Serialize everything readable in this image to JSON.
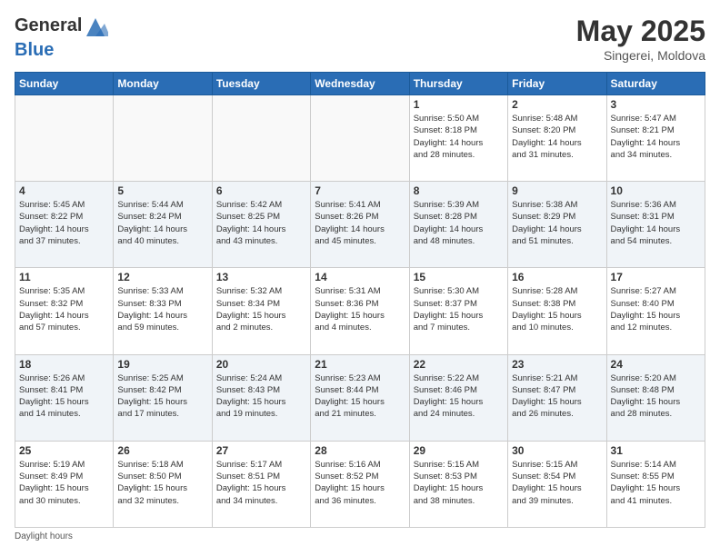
{
  "header": {
    "logo_general": "General",
    "logo_blue": "Blue",
    "title": "May 2025",
    "location": "Singerei, Moldova"
  },
  "calendar": {
    "days_of_week": [
      "Sunday",
      "Monday",
      "Tuesday",
      "Wednesday",
      "Thursday",
      "Friday",
      "Saturday"
    ],
    "weeks": [
      [
        {
          "day": "",
          "info": ""
        },
        {
          "day": "",
          "info": ""
        },
        {
          "day": "",
          "info": ""
        },
        {
          "day": "",
          "info": ""
        },
        {
          "day": "1",
          "info": "Sunrise: 5:50 AM\nSunset: 8:18 PM\nDaylight: 14 hours\nand 28 minutes."
        },
        {
          "day": "2",
          "info": "Sunrise: 5:48 AM\nSunset: 8:20 PM\nDaylight: 14 hours\nand 31 minutes."
        },
        {
          "day": "3",
          "info": "Sunrise: 5:47 AM\nSunset: 8:21 PM\nDaylight: 14 hours\nand 34 minutes."
        }
      ],
      [
        {
          "day": "4",
          "info": "Sunrise: 5:45 AM\nSunset: 8:22 PM\nDaylight: 14 hours\nand 37 minutes."
        },
        {
          "day": "5",
          "info": "Sunrise: 5:44 AM\nSunset: 8:24 PM\nDaylight: 14 hours\nand 40 minutes."
        },
        {
          "day": "6",
          "info": "Sunrise: 5:42 AM\nSunset: 8:25 PM\nDaylight: 14 hours\nand 43 minutes."
        },
        {
          "day": "7",
          "info": "Sunrise: 5:41 AM\nSunset: 8:26 PM\nDaylight: 14 hours\nand 45 minutes."
        },
        {
          "day": "8",
          "info": "Sunrise: 5:39 AM\nSunset: 8:28 PM\nDaylight: 14 hours\nand 48 minutes."
        },
        {
          "day": "9",
          "info": "Sunrise: 5:38 AM\nSunset: 8:29 PM\nDaylight: 14 hours\nand 51 minutes."
        },
        {
          "day": "10",
          "info": "Sunrise: 5:36 AM\nSunset: 8:31 PM\nDaylight: 14 hours\nand 54 minutes."
        }
      ],
      [
        {
          "day": "11",
          "info": "Sunrise: 5:35 AM\nSunset: 8:32 PM\nDaylight: 14 hours\nand 57 minutes."
        },
        {
          "day": "12",
          "info": "Sunrise: 5:33 AM\nSunset: 8:33 PM\nDaylight: 14 hours\nand 59 minutes."
        },
        {
          "day": "13",
          "info": "Sunrise: 5:32 AM\nSunset: 8:34 PM\nDaylight: 15 hours\nand 2 minutes."
        },
        {
          "day": "14",
          "info": "Sunrise: 5:31 AM\nSunset: 8:36 PM\nDaylight: 15 hours\nand 4 minutes."
        },
        {
          "day": "15",
          "info": "Sunrise: 5:30 AM\nSunset: 8:37 PM\nDaylight: 15 hours\nand 7 minutes."
        },
        {
          "day": "16",
          "info": "Sunrise: 5:28 AM\nSunset: 8:38 PM\nDaylight: 15 hours\nand 10 minutes."
        },
        {
          "day": "17",
          "info": "Sunrise: 5:27 AM\nSunset: 8:40 PM\nDaylight: 15 hours\nand 12 minutes."
        }
      ],
      [
        {
          "day": "18",
          "info": "Sunrise: 5:26 AM\nSunset: 8:41 PM\nDaylight: 15 hours\nand 14 minutes."
        },
        {
          "day": "19",
          "info": "Sunrise: 5:25 AM\nSunset: 8:42 PM\nDaylight: 15 hours\nand 17 minutes."
        },
        {
          "day": "20",
          "info": "Sunrise: 5:24 AM\nSunset: 8:43 PM\nDaylight: 15 hours\nand 19 minutes."
        },
        {
          "day": "21",
          "info": "Sunrise: 5:23 AM\nSunset: 8:44 PM\nDaylight: 15 hours\nand 21 minutes."
        },
        {
          "day": "22",
          "info": "Sunrise: 5:22 AM\nSunset: 8:46 PM\nDaylight: 15 hours\nand 24 minutes."
        },
        {
          "day": "23",
          "info": "Sunrise: 5:21 AM\nSunset: 8:47 PM\nDaylight: 15 hours\nand 26 minutes."
        },
        {
          "day": "24",
          "info": "Sunrise: 5:20 AM\nSunset: 8:48 PM\nDaylight: 15 hours\nand 28 minutes."
        }
      ],
      [
        {
          "day": "25",
          "info": "Sunrise: 5:19 AM\nSunset: 8:49 PM\nDaylight: 15 hours\nand 30 minutes."
        },
        {
          "day": "26",
          "info": "Sunrise: 5:18 AM\nSunset: 8:50 PM\nDaylight: 15 hours\nand 32 minutes."
        },
        {
          "day": "27",
          "info": "Sunrise: 5:17 AM\nSunset: 8:51 PM\nDaylight: 15 hours\nand 34 minutes."
        },
        {
          "day": "28",
          "info": "Sunrise: 5:16 AM\nSunset: 8:52 PM\nDaylight: 15 hours\nand 36 minutes."
        },
        {
          "day": "29",
          "info": "Sunrise: 5:15 AM\nSunset: 8:53 PM\nDaylight: 15 hours\nand 38 minutes."
        },
        {
          "day": "30",
          "info": "Sunrise: 5:15 AM\nSunset: 8:54 PM\nDaylight: 15 hours\nand 39 minutes."
        },
        {
          "day": "31",
          "info": "Sunrise: 5:14 AM\nSunset: 8:55 PM\nDaylight: 15 hours\nand 41 minutes."
        }
      ]
    ]
  },
  "footer": {
    "note": "Daylight hours"
  }
}
